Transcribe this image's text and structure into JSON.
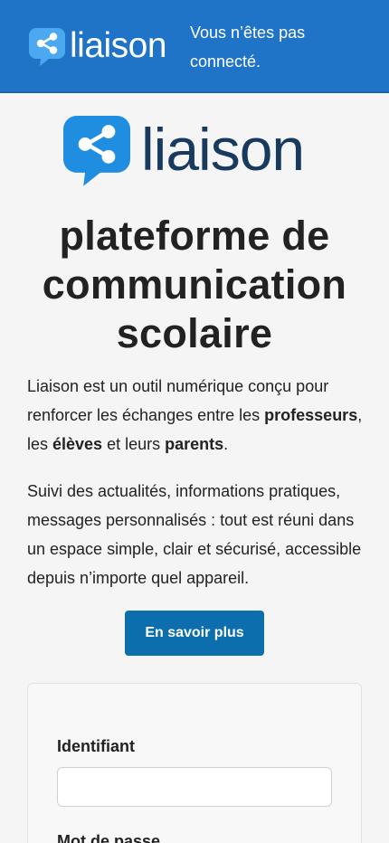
{
  "header": {
    "logo_text": "liaison",
    "status_text": "Vous n’êtes pas connecté."
  },
  "hero": {
    "logo_text": "liaison",
    "title": "plateforme de communication scolaire"
  },
  "intro": {
    "p1_a": "Liaison est un outil numérique conçu pour renforcer les échanges entre les ",
    "p1_professeurs": "professeurs",
    "p1_b": ", les ",
    "p1_eleves": "élèves",
    "p1_c": " et leurs ",
    "p1_parents": "parents",
    "p1_d": ".",
    "p2": "Suivi des actualités, informations pratiques, messages personnalisés : tout est réuni dans un espace simple, clair et sécurisé, accessible depuis n’importe quel appareil."
  },
  "cta": {
    "label": "En savoir plus"
  },
  "login": {
    "username_label": "Identifiant",
    "username_value": "",
    "password_label": "Mot de passe"
  },
  "colors": {
    "header_bg": "#1f74c8",
    "brand_blue": "#1f8ee0",
    "brand_dark": "#173a5e",
    "button_bg": "#0d6ead"
  },
  "icons": {
    "logo": "share-bubble-icon"
  }
}
